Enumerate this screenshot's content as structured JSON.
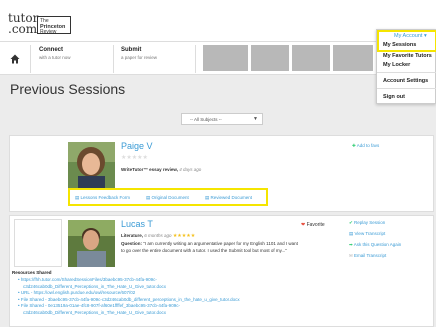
{
  "logo": {
    "tutor": "tutor",
    "com": ".com",
    "the": "The",
    "princeton": "Princeton",
    "review": "Review"
  },
  "header": {
    "account_label": "My Account ▾"
  },
  "nav": {
    "connect_title": "Connect",
    "connect_sub": "with a tutor now",
    "submit_title": "Submit",
    "submit_sub": "a paper for review"
  },
  "menu": {
    "account": "My Account ▾",
    "sessions": "My Sessions",
    "favorites": "My Favorite Tutors",
    "locker": "My Locker",
    "settings": "Account Settings",
    "signout": "Sign out"
  },
  "page_title": "Previous Sessions",
  "filter": {
    "value": "-- All Subjects --"
  },
  "sessions": [
    {
      "name": "Paige V",
      "add_favorite": "Add to favs",
      "service": "WriteTutor™ essay review,",
      "time": "4 days ago",
      "actions": [
        "Lessons Feedback Form",
        "Original Document",
        "Reviewed Document"
      ]
    },
    {
      "name": "Lucas T",
      "favorite": "Favorite",
      "subject": "Literature,",
      "time": "6 months ago",
      "question_label": "Question:",
      "question": "\"I am currently writing an argumentative paper for my English 1101 and I want to go over the entire document with a tutor. I used the Submit tool but most of my...\"",
      "side_actions": [
        "Replay Session",
        "View Transcript",
        "Ask this Question Again",
        "Email Transcript"
      ],
      "resources_label": "Resources Shared",
      "resources": [
        "https://fhh.tutor.com/SharedSessionFiles/3baebc95-37cb-44fa-909c-",
        "c3d246cab0db_Different_Perceptions_in_The_Hate_U_Give_tutor.docx",
        "URL - https://owl.english.purdue.edu/owl/resource/607/02",
        "File Shared - 3baebc95-37cb-44fa-909c-c3d246cab0db_different_perceptions_in_the_hate_u_give_tutor.docx",
        "File Shared - 0e13519a-01ae-4fc8-907f-af60e1ffffef_3baebc95-37cb-44fa-909c-",
        "c3d246cab0db_Different_Perceptions_in_The_Hate_U_Give_tutor.docx"
      ]
    }
  ],
  "colors": {
    "highlight": "#f5e500",
    "link": "#3a9bd5",
    "star": "#f4c01a",
    "favorite": "#e74c3c",
    "add": "#2ecc71"
  }
}
